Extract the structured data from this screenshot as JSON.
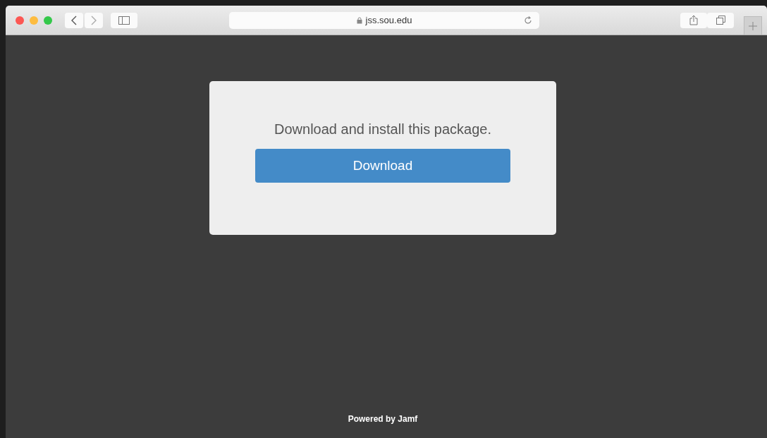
{
  "browser": {
    "url": "jss.sou.edu"
  },
  "card": {
    "message": "Download and install this package.",
    "button": "Download"
  },
  "footer": "Powered by Jamf"
}
